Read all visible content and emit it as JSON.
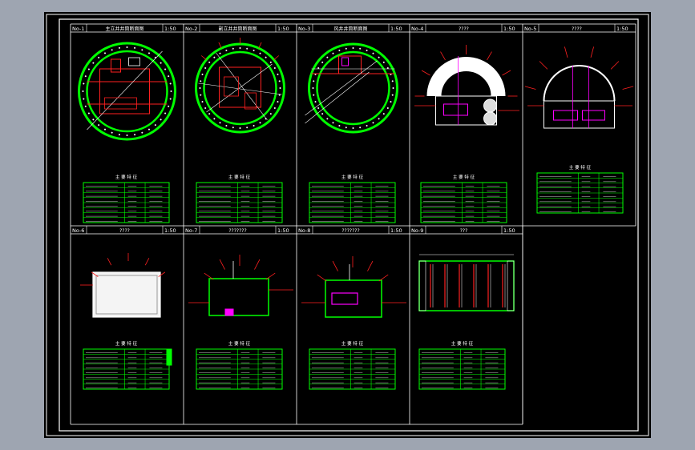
{
  "colors": {
    "background": "#9ea5b1",
    "sheet": "#000000",
    "frame": "#ffffff",
    "green": "#00ff00",
    "red": "#ff2020",
    "magenta": "#ff00ff",
    "white": "#ffffff"
  },
  "panels": [
    {
      "no": "No-1",
      "title": "主立井井筒断面图",
      "scale": "1:50",
      "type": "circle-detailed"
    },
    {
      "no": "No-2",
      "title": "副立井井筒断面图",
      "scale": "1:50",
      "type": "circle-cross"
    },
    {
      "no": "No-3",
      "title": "风井井筒断面图",
      "scale": "1:50",
      "type": "circle-simple"
    },
    {
      "no": "No-4",
      "title": "????",
      "scale": "1:50",
      "type": "arch"
    },
    {
      "no": "No-5",
      "title": "????",
      "scale": "1:50",
      "type": "arch-outline"
    },
    {
      "no": "No-6",
      "title": "????",
      "scale": "1:50",
      "type": "rect-gray"
    },
    {
      "no": "No-7",
      "title": "???????",
      "scale": "1:50",
      "type": "rect-small"
    },
    {
      "no": "No-8",
      "title": "???????",
      "scale": "1:50",
      "type": "rect-magenta"
    },
    {
      "no": "No-9",
      "title": "???",
      "scale": "1:50",
      "type": "rect-columns"
    }
  ],
  "table_title": "主 要 特 征"
}
